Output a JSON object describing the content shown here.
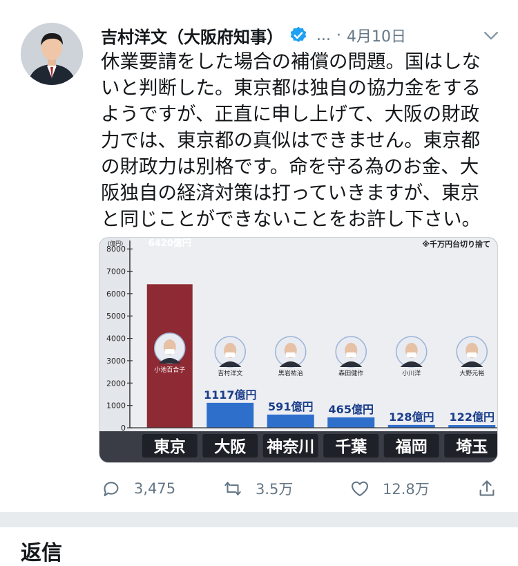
{
  "tweet": {
    "author_name": "吉村洋文（大阪府知事）",
    "handle": "...",
    "separator": "·",
    "date": "4月10日",
    "text": "休業要請をした場合の補償の問題。国はしないと判断した。東京都は独自の協力金をするようですが、正直に申し上げて、大阪の財政力では、東京都の真似はできません。東京都の財政力は別格です。命を守る為のお金、大阪独自の経済対策は打っていきますが、東京と同じことができないことをお許し下さい。",
    "actions": {
      "reply_count": "3,475",
      "retweet_count": "3.5万",
      "like_count": "12.8万"
    }
  },
  "replies_heading": "返信",
  "colors": {
    "verified": "#1da1f2",
    "secondary_text": "#657786",
    "tokyo_bar": "#8e2a33",
    "other_bars": "#2f6fcc"
  },
  "chart_data": {
    "type": "bar",
    "yunit": "(億円)",
    "note": "※千万円台切り捨て",
    "ylim": [
      0,
      8500
    ],
    "yticks": [
      0,
      1000,
      2000,
      3000,
      4000,
      5000,
      6000,
      7000,
      8000
    ],
    "categories": [
      "東京",
      "大阪",
      "神奈川",
      "千葉",
      "福岡",
      "埼玉"
    ],
    "values": [
      6420,
      1117,
      591,
      465,
      128,
      122
    ],
    "value_labels": [
      "6420億円",
      "1117億円",
      "591億円",
      "465億円",
      "128億円",
      "122億円"
    ],
    "governors": [
      "小池百合子",
      "吉村洋文",
      "黒岩祐治",
      "森田健作",
      "小川洋",
      "大野元裕"
    ]
  }
}
